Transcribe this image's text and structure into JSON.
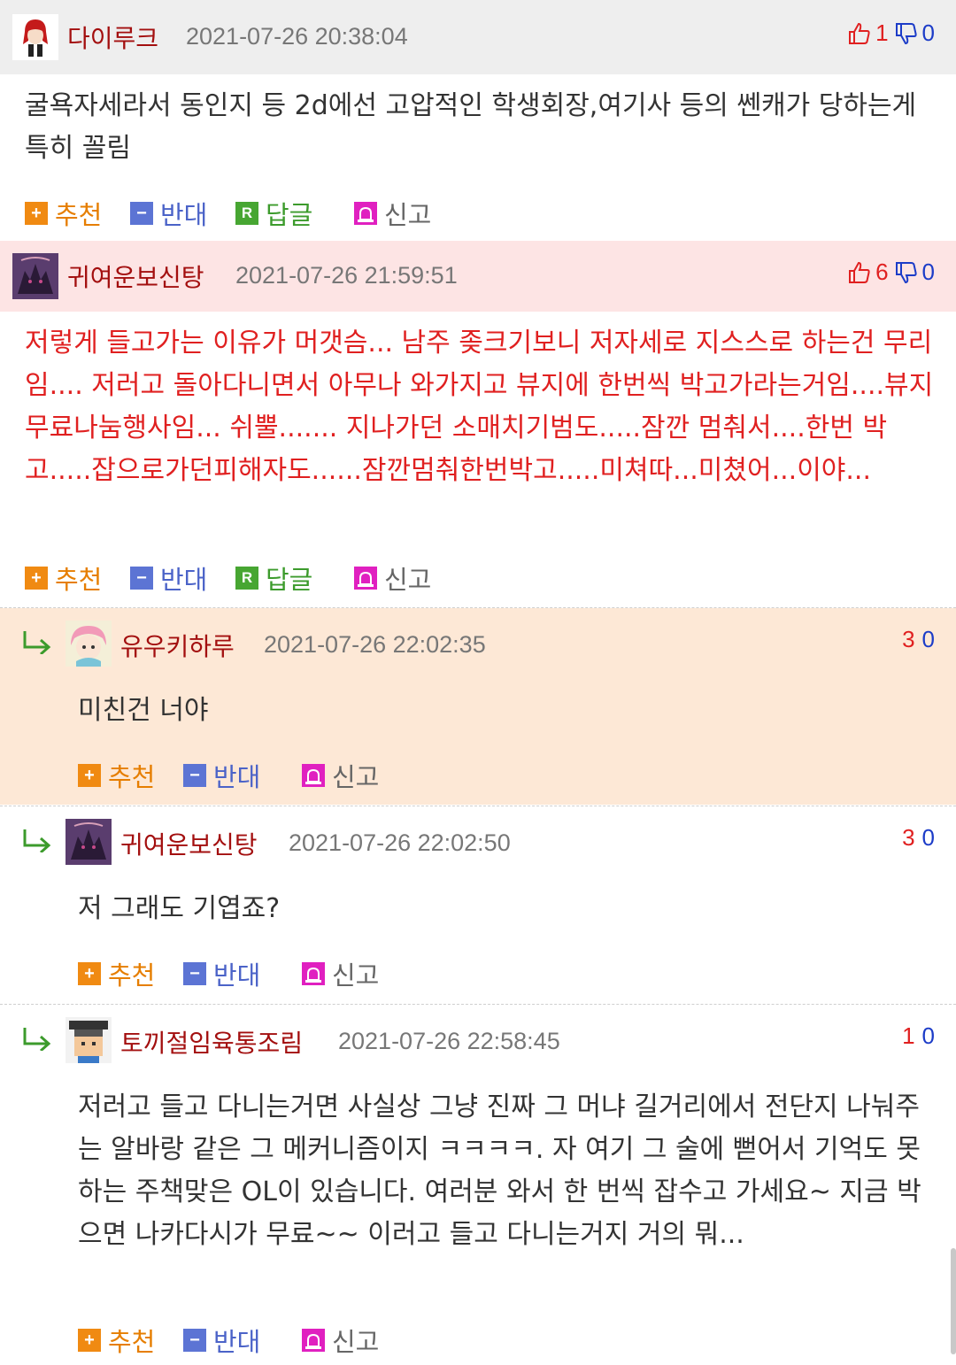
{
  "comments": [
    {
      "nickname": "다이루크",
      "date": "2021-07-26 20:38:04",
      "up": "1",
      "down": "0",
      "text": "굴욕자세라서 동인지 등 2d에선 고압적인 학생회장,여기사 등의 쎈캐가 당하는게 특히 꼴림",
      "recommend_label": "추천",
      "oppose_label": "반대",
      "reply_label": "답글",
      "report_label": "신고"
    },
    {
      "nickname": "귀여운보신탕",
      "date": "2021-07-26 21:59:51",
      "up": "6",
      "down": "0",
      "text": "저렇게 들고가는 이유가 머갯슴... 남주 좆크기보니 저자세로 지스스로 하는건 무리임.... 저러고 돌아다니면서 아무나 와가지고 뷰지에 한번씩 박고가라는거임....뷰지무료나눔행사임... 쉬뿔....... 지나가던 소매치기범도.....잠깐 멈춰서....한번 박고.....잡으로가던피해자도......잠깐멈춰한번박고.....미쳐따...미쳤어...이야...",
      "recommend_label": "추천",
      "oppose_label": "반대",
      "reply_label": "답글",
      "report_label": "신고"
    },
    {
      "nickname": "유우키하루",
      "date": "2021-07-26 22:02:35",
      "up": "3",
      "down": "0",
      "text": "미친건 너야",
      "recommend_label": "추천",
      "oppose_label": "반대",
      "report_label": "신고"
    },
    {
      "nickname": "귀여운보신탕",
      "date": "2021-07-26 22:02:50",
      "up": "3",
      "down": "0",
      "text": "저 그래도 기엽죠?",
      "recommend_label": "추천",
      "oppose_label": "반대",
      "report_label": "신고"
    },
    {
      "nickname": "토끼절임육통조림",
      "date": "2021-07-26 22:58:45",
      "up": "1",
      "down": "0",
      "text": "저러고 들고 다니는거면 사실상 그냥 진짜 그 머냐 길거리에서 전단지 나눠주는 알바랑 같은 그 메커니즘이지 ㅋㅋㅋㅋ. 자 여기 그 술에 뻗어서 기억도 못하는 주책맞은 OL이 있습니다. 여러분 와서 한 번씩 잡수고 가세요~ 지금 박으면 나카다시가 무료~~ 이러고 들고 다니는거지 거의 뭐...",
      "recommend_label": "추천",
      "oppose_label": "반대",
      "report_label": "신고"
    }
  ],
  "colors": {
    "header_gray": "#eeeeee",
    "best_pink": "#fde4e4",
    "reply_highlight": "#fde8d6",
    "nick_red": "#a30f0f",
    "best_text_red": "#e02020"
  }
}
